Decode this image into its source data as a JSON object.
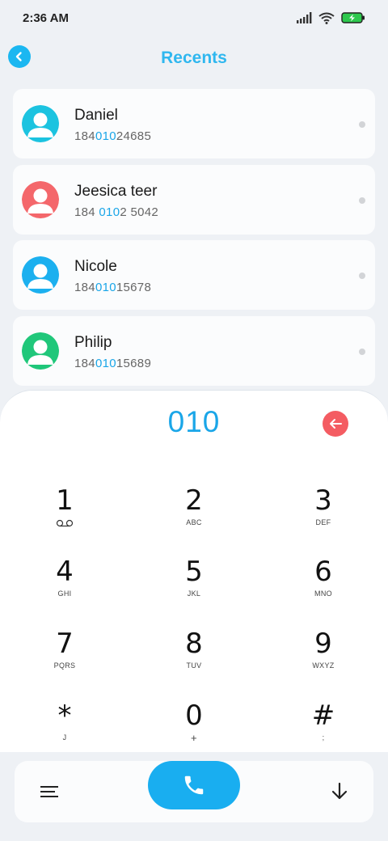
{
  "status_bar": {
    "time": "2:36 AM"
  },
  "header": {
    "title": "Recents"
  },
  "contacts": [
    {
      "name": "Daniel",
      "number_pre": "184",
      "number_match": "010",
      "number_post": "24685",
      "avatar_color": "#1cc3e0"
    },
    {
      "name": "Jeesica teer",
      "number_pre": "184 ",
      "number_match": "010",
      "number_post": "2 5042",
      "avatar_color": "#f4676b"
    },
    {
      "name": "Nicole",
      "number_pre": "184",
      "number_match": "010",
      "number_post": "15678",
      "avatar_color": "#1cb0ef"
    },
    {
      "name": "Philip",
      "number_pre": "184",
      "number_match": "010",
      "number_post": "15689",
      "avatar_color": "#20c77a"
    }
  ],
  "dialer": {
    "display": "010",
    "keys": [
      {
        "digit": "1",
        "letters": ""
      },
      {
        "digit": "2",
        "letters": "ABC"
      },
      {
        "digit": "3",
        "letters": "DEF"
      },
      {
        "digit": "4",
        "letters": "GHI"
      },
      {
        "digit": "5",
        "letters": "JKL"
      },
      {
        "digit": "6",
        "letters": "MNO"
      },
      {
        "digit": "7",
        "letters": "PQRS"
      },
      {
        "digit": "8",
        "letters": "TUV"
      },
      {
        "digit": "9",
        "letters": "WXYZ"
      },
      {
        "digit": "*",
        "letters": "J"
      },
      {
        "digit": "0",
        "letters": "+"
      },
      {
        "digit": "#",
        "letters": ";"
      }
    ]
  },
  "colors": {
    "accent": "#1aa6e8",
    "backspace": "#f45c62",
    "call": "#19aef0"
  }
}
